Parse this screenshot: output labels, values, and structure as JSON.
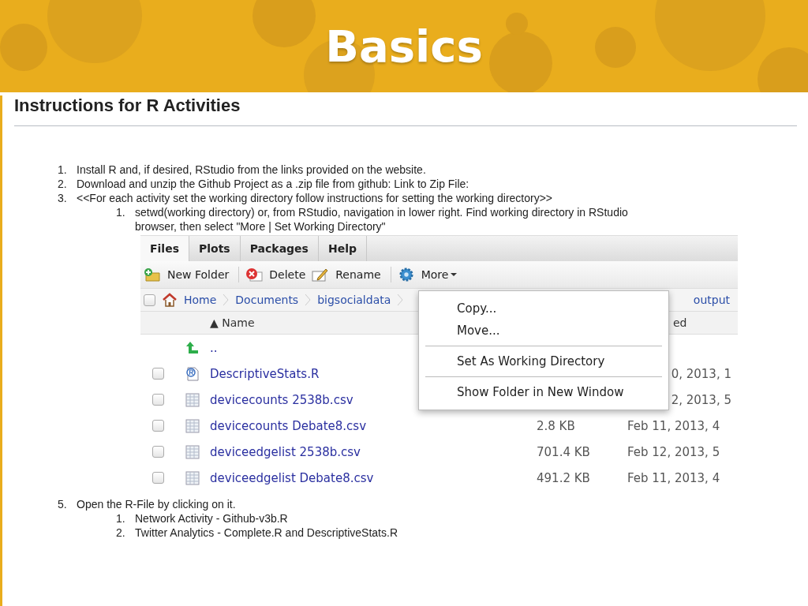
{
  "slide": {
    "title": "Basics"
  },
  "page": {
    "heading": "Instructions for R Activities"
  },
  "steps": [
    {
      "number": "1.",
      "text": "Install R and, if desired, RStudio from the links provided on the website."
    },
    {
      "number": "2.",
      "text": "Download and unzip the Github Project as a .zip file from github: Link to Zip File:"
    },
    {
      "number": "3.",
      "text": "<<For each activity set the working directory follow instructions for setting the working directory>>",
      "children": [
        {
          "number": "1.",
          "text": "setwd(working directory) or, from RStudio, navigation in lower right.  Find working directory in RStudio browser, then select \"More | Set Working Directory\""
        }
      ]
    }
  ],
  "files_pane": {
    "tabs": [
      {
        "label": "Files",
        "selected": true
      },
      {
        "label": "Plots",
        "selected": false
      },
      {
        "label": "Packages",
        "selected": false
      },
      {
        "label": "Help",
        "selected": false
      }
    ],
    "toolbar": [
      {
        "kind": "new-folder",
        "label": "New Folder"
      },
      {
        "kind": "delete",
        "label": "Delete"
      },
      {
        "kind": "rename",
        "label": "Rename"
      },
      {
        "kind": "more",
        "label": "More",
        "caret": true
      }
    ],
    "breadcrumb": {
      "checked": false,
      "items": [
        "Home",
        "Documents",
        "bigsocialdata",
        "output"
      ]
    },
    "columns": {
      "name": {
        "label": "Name",
        "sort": "▲"
      },
      "modified": {
        "label": "ed"
      }
    },
    "rows": [
      {
        "kind": "parent",
        "name": ".."
      },
      {
        "kind": "r-script",
        "name": "DescriptiveStats.R",
        "checked": false,
        "modified": "0, 2013, 1"
      },
      {
        "kind": "csv",
        "name": "devicecounts 2538b.csv",
        "checked": false,
        "modified": "2, 2013, 5"
      },
      {
        "kind": "csv",
        "name": "devicecounts Debate8.csv",
        "checked": false,
        "size": "2.8 KB",
        "modified": "Feb 11, 2013, 4"
      },
      {
        "kind": "csv",
        "name": "deviceedgelist 2538b.csv",
        "checked": false,
        "size": "701.4 KB",
        "modified": "Feb 12, 2013, 5"
      },
      {
        "kind": "csv",
        "name": "deviceedgelist Debate8.csv",
        "checked": false,
        "size": "491.2 KB",
        "modified": "Feb 11, 2013, 4"
      }
    ],
    "menu": [
      {
        "kind": "item",
        "label": "Copy..."
      },
      {
        "kind": "item",
        "label": "Move..."
      },
      {
        "kind": "separator"
      },
      {
        "kind": "item",
        "label": "Set As Working Directory"
      },
      {
        "kind": "separator"
      },
      {
        "kind": "item",
        "label": "Show Folder in New Window"
      }
    ]
  },
  "steps_after": [
    {
      "number": "5.",
      "text": "Open the R-File by clicking on it.",
      "children": [
        {
          "number": "1.",
          "text": "Network Activity - Github-v3b.R"
        },
        {
          "number": "2.",
          "text": "Twitter Analytics - Complete.R and DescriptiveStats.R"
        }
      ]
    }
  ]
}
